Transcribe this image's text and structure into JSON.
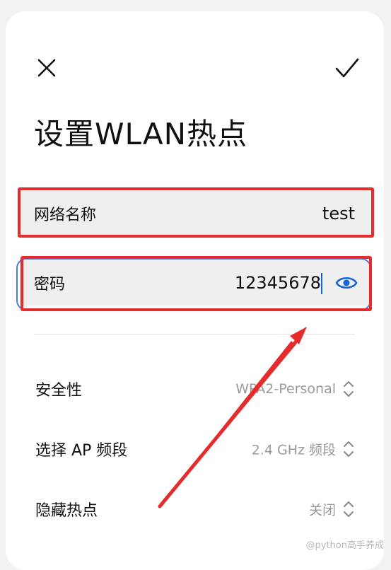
{
  "header": {
    "title": "设置WLAN热点",
    "close_icon": "close-icon",
    "confirm_icon": "check-icon"
  },
  "fields": {
    "network_name": {
      "label": "网络名称",
      "value": "test"
    },
    "password": {
      "label": "密码",
      "value": "12345678",
      "icon": "eye-icon"
    }
  },
  "settings": [
    {
      "label": "安全性",
      "value": "WPA2-Personal"
    },
    {
      "label": "选择 AP 频段",
      "value": "2.4 GHz 频段"
    },
    {
      "label": "隐藏热点",
      "value": "关闭"
    }
  ],
  "watermark": "@python高手养成",
  "colors": {
    "accent": "#1565d8",
    "annotation": "#e52b2b",
    "secondary_text": "#9a9a9a"
  }
}
